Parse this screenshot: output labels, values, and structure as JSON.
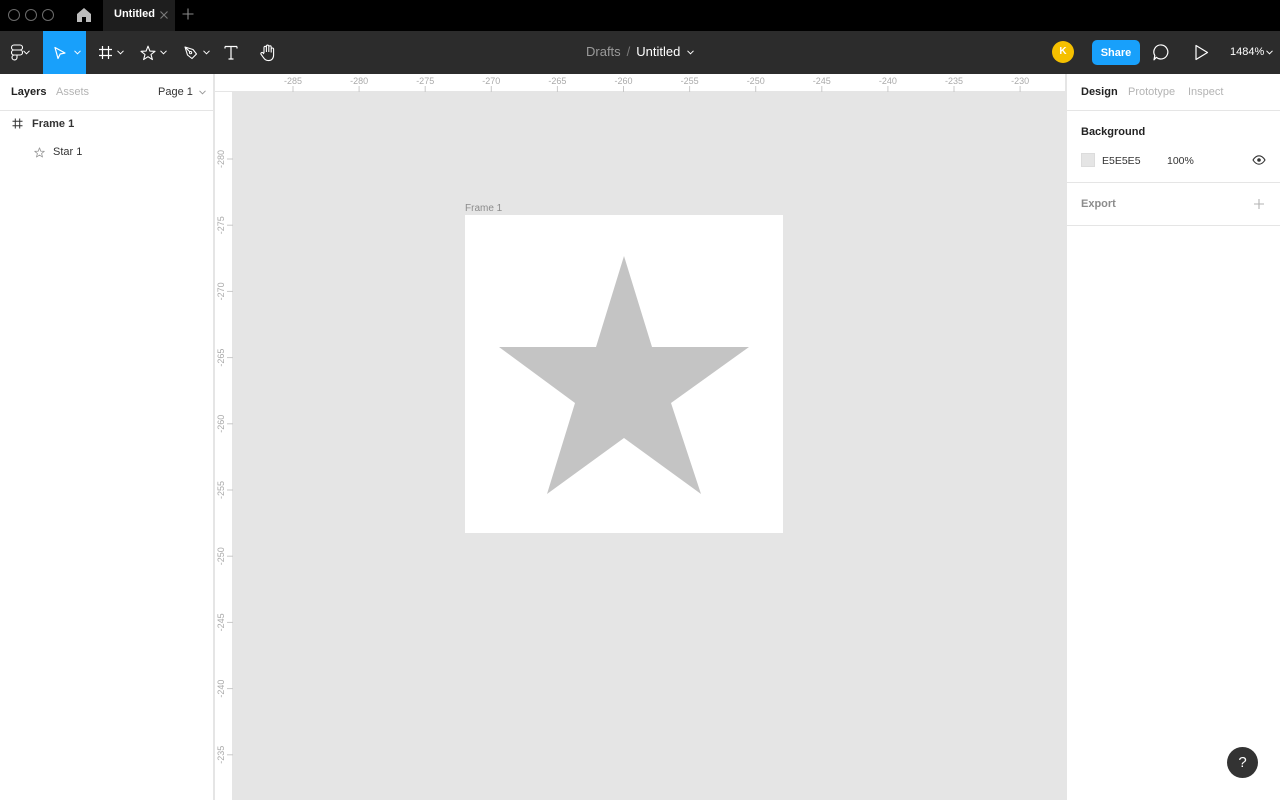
{
  "tabbar": {
    "tab_title": "Untitled"
  },
  "toolbar": {
    "breadcrumb_parent": "Drafts",
    "breadcrumb_separator": "/",
    "file_title": "Untitled",
    "avatar_initial": "K",
    "share_label": "Share",
    "zoom_level": "1484%",
    "active_tool": "move-tool",
    "accent_color": "#18a0fb",
    "avatar_color": "#f5c000"
  },
  "left_panel": {
    "tabs": [
      "Layers",
      "Assets"
    ],
    "page_select": "Page 1",
    "layers": [
      {
        "name": "Frame 1",
        "icon": "frame-hash-icon"
      },
      {
        "name": "Star 1",
        "icon": "star-outline-icon"
      }
    ]
  },
  "rulers": {
    "horizontal": [
      "-285",
      "-280",
      "-275",
      "-270",
      "-265",
      "-260",
      "-255",
      "-250",
      "-245",
      "-240",
      "-235",
      "-230"
    ],
    "vertical": [
      "-280",
      "-275",
      "-270",
      "-265",
      "-260",
      "-255",
      "-250",
      "-245",
      "-240",
      "-235"
    ]
  },
  "canvas": {
    "frame_label": "Frame 1",
    "background_color": "#e5e5e5",
    "frame_fill": "#ffffff",
    "star_fill": "#c4c4c4"
  },
  "right_panel": {
    "tabs": [
      "Design",
      "Prototype",
      "Inspect"
    ],
    "background_title": "Background",
    "background_hex": "E5E5E5",
    "background_opacity": "100%",
    "export_title": "Export"
  },
  "help": {
    "label": "?"
  }
}
